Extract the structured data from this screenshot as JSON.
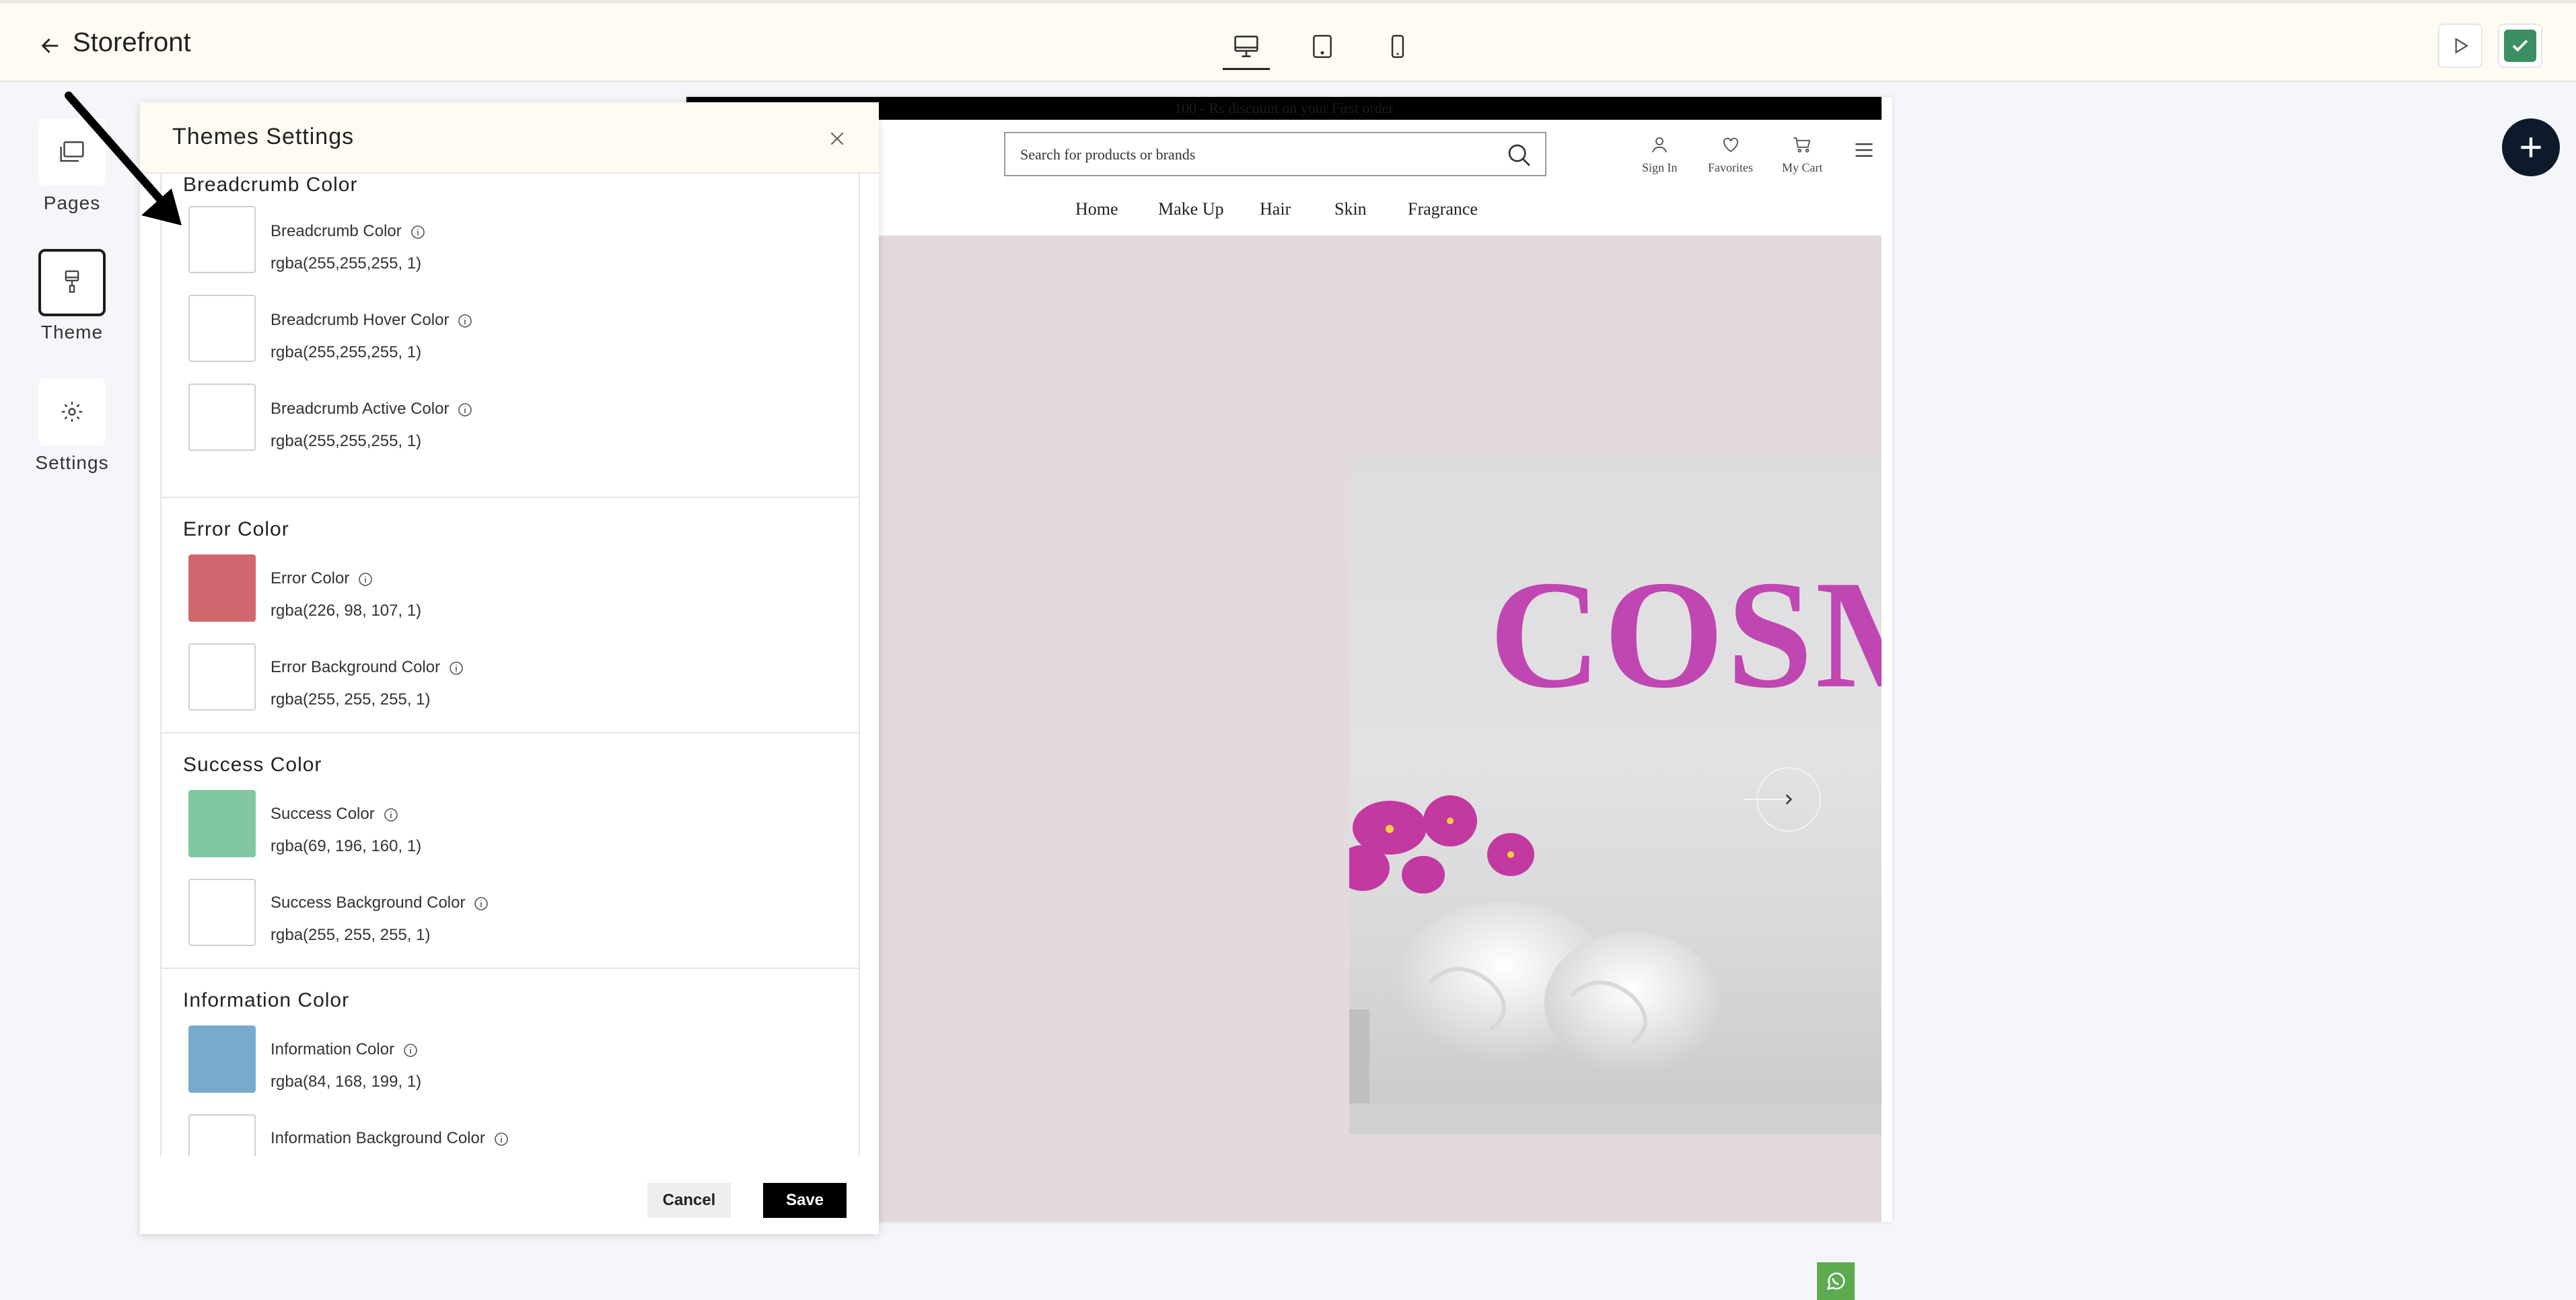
{
  "topbar": {
    "title": "Storefront",
    "device_modes": [
      "desktop",
      "tablet",
      "mobile"
    ],
    "active_device": "desktop"
  },
  "sidebar": {
    "items": [
      {
        "label": "Pages",
        "icon": "pages-icon"
      },
      {
        "label": "Theme",
        "icon": "brush-icon",
        "active": true
      },
      {
        "label": "Settings",
        "icon": "gear-icon"
      }
    ]
  },
  "theme_panel": {
    "title": "Themes Settings",
    "sections": [
      {
        "title": "Breadcrumb Color",
        "colors": [
          {
            "label": "Breadcrumb Color",
            "value": "rgba(255,255,255, 1)",
            "swatch": "#ffffff"
          },
          {
            "label": "Breadcrumb Hover Color",
            "value": "rgba(255,255,255, 1)",
            "swatch": "#ffffff"
          },
          {
            "label": "Breadcrumb Active Color",
            "value": "rgba(255,255,255, 1)",
            "swatch": "#ffffff"
          }
        ]
      },
      {
        "title": "Error Color",
        "colors": [
          {
            "label": "Error Color",
            "value": "rgba(226, 98, 107, 1)",
            "swatch": "#d2666d"
          },
          {
            "label": "Error Background Color",
            "value": "rgba(255, 255, 255, 1)",
            "swatch": "#ffffff"
          }
        ]
      },
      {
        "title": "Success Color",
        "colors": [
          {
            "label": "Success Color",
            "value": "rgba(69, 196, 160, 1)",
            "swatch": "#80c7a2"
          },
          {
            "label": "Success Background Color",
            "value": "rgba(255, 255, 255, 1)",
            "swatch": "#ffffff"
          }
        ]
      },
      {
        "title": "Information Color",
        "colors": [
          {
            "label": "Information Color",
            "value": "rgba(84, 168, 199, 1)",
            "swatch": "#78aacd"
          },
          {
            "label": "Information Background Color",
            "value": "rgba(255, 255, 255, 1)",
            "swatch": "#ffffff"
          }
        ]
      }
    ],
    "cancel_label": "Cancel",
    "save_label": "Save"
  },
  "preview": {
    "promo": "100 - Rs discount on your First order",
    "search_placeholder": "Search for products or brands",
    "header_actions": [
      "Sign In",
      "Favorites",
      "My Cart"
    ],
    "nav": [
      "Home",
      "Make Up",
      "Hair",
      "Skin",
      "Fragrance"
    ],
    "hero_text": "COSM"
  }
}
